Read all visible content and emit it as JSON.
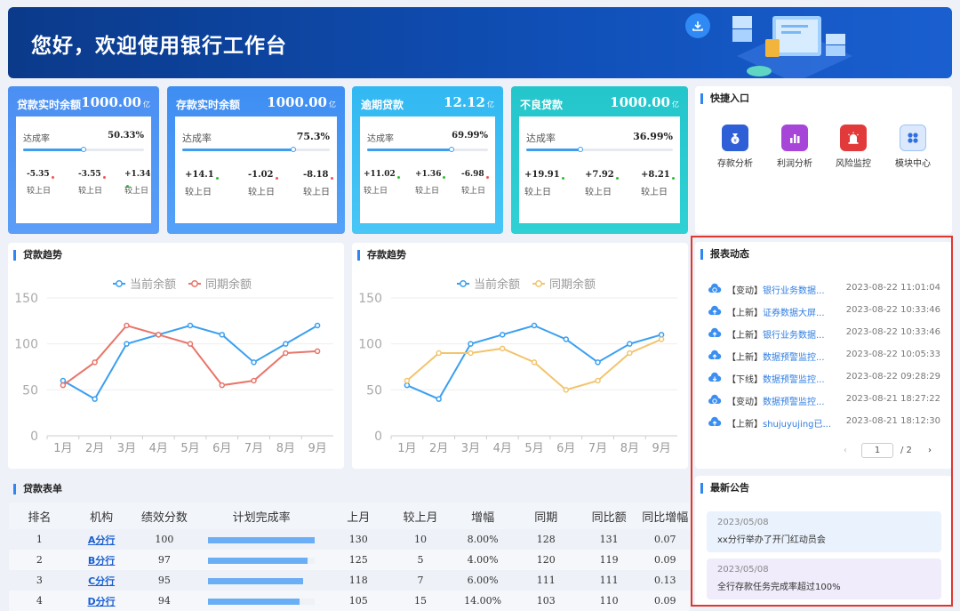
{
  "banner": {
    "title": "您好，欢迎使用银行工作台"
  },
  "cards": [
    {
      "title": "贷款实时余额",
      "value": "1000.00",
      "unit": "亿",
      "rate_label": "达成率",
      "rate": "50.33%",
      "rate_fraction": 0.5,
      "cmp": [
        {
          "v": "-5.35",
          "l": "较上日"
        },
        {
          "v": "-3.55",
          "l": "较上日"
        },
        {
          "v": "+1.34",
          "l": "较上日"
        }
      ]
    },
    {
      "title": "存款实时余额",
      "value": "1000.00",
      "unit": "亿",
      "rate_label": "达成率",
      "rate": "75.3%",
      "rate_fraction": 0.75,
      "cmp": [
        {
          "v": "+14.1",
          "l": "较上日"
        },
        {
          "v": "-1.02",
          "l": "较上日"
        },
        {
          "v": "-8.18",
          "l": "较上日"
        }
      ]
    },
    {
      "title": "逾期贷款",
      "value": "12.12",
      "unit": "亿",
      "rate_label": "达成率",
      "rate": "69.99%",
      "rate_fraction": 0.7,
      "cmp": [
        {
          "v": "+11.02",
          "l": "较上日"
        },
        {
          "v": "+1.36",
          "l": "较上日"
        },
        {
          "v": "-6.98",
          "l": "较上日"
        }
      ]
    },
    {
      "title": "不良贷款",
      "value": "1000.00",
      "unit": "亿",
      "rate_label": "达成率",
      "rate": "36.99%",
      "rate_fraction": 0.37,
      "cmp": [
        {
          "v": "+19.91",
          "l": "较上日"
        },
        {
          "v": "+7.92",
          "l": "较上日"
        },
        {
          "v": "+8.21",
          "l": "较上日"
        }
      ]
    }
  ],
  "quick": {
    "title": "快捷入口",
    "items": [
      {
        "label": "存款分析",
        "icon": "money-bag-icon",
        "color": "#2f5fd6"
      },
      {
        "label": "利润分析",
        "icon": "bar-chart-icon",
        "color": "#a645d8"
      },
      {
        "label": "风险监控",
        "icon": "alarm-icon",
        "color": "#e23a3a"
      },
      {
        "label": "模块中心",
        "icon": "grid-icon",
        "color": "#dce9fc"
      }
    ]
  },
  "reports": {
    "title": "报表动态",
    "items": [
      {
        "tag": "【变动】",
        "name": "银行业务数据...",
        "time": "2023-08-22 11:01:04",
        "icon": "cloud-sync-icon"
      },
      {
        "tag": "【上新】",
        "name": "证券数据大屏...",
        "time": "2023-08-22 10:33:46",
        "icon": "cloud-upload-icon"
      },
      {
        "tag": "【上新】",
        "name": "银行业务数据...",
        "time": "2023-08-22 10:33:46",
        "icon": "cloud-upload-icon"
      },
      {
        "tag": "【上新】",
        "name": "数据预警监控...",
        "time": "2023-08-22 10:05:33",
        "icon": "cloud-upload-icon"
      },
      {
        "tag": "【下线】",
        "name": "数据预警监控...",
        "time": "2023-08-22 09:28:29",
        "icon": "cloud-download-icon"
      },
      {
        "tag": "【变动】",
        "name": "数据预警监控...",
        "time": "2023-08-21 18:27:22",
        "icon": "cloud-sync-icon"
      },
      {
        "tag": "【上新】",
        "name": "shujuyujing已...",
        "time": "2023-08-21 18:12:30",
        "icon": "cloud-upload-icon"
      }
    ],
    "pager": {
      "current": "1",
      "total": "/ 2"
    }
  },
  "notices": {
    "title": "最新公告",
    "items": [
      {
        "date": "2023/05/08",
        "text": "xx分行举办了开门红动员会"
      },
      {
        "date": "2023/05/08",
        "text": "全行存款任务完成率超过100%"
      }
    ]
  },
  "chart_data": [
    {
      "type": "line",
      "panel_title": "贷款趋势",
      "x": [
        "1月",
        "2月",
        "3月",
        "4月",
        "5月",
        "6月",
        "7月",
        "8月",
        "9月"
      ],
      "ylim": [
        0,
        150
      ],
      "yticks": [
        "0",
        "50",
        "100",
        "150"
      ],
      "series": [
        {
          "name": "当前余额",
          "color": "#3a9ff0",
          "values": [
            60,
            40,
            100,
            110,
            120,
            110,
            80,
            100,
            120
          ]
        },
        {
          "name": "同期余额",
          "color": "#e8766a",
          "values": [
            55,
            80,
            120,
            110,
            100,
            55,
            60,
            90,
            92
          ]
        }
      ]
    },
    {
      "type": "line",
      "panel_title": "存款趋势",
      "x": [
        "1月",
        "2月",
        "3月",
        "4月",
        "5月",
        "6月",
        "7月",
        "8月",
        "9月"
      ],
      "ylim": [
        0,
        150
      ],
      "yticks": [
        "0",
        "50",
        "100",
        "150"
      ],
      "series": [
        {
          "name": "当前余额",
          "color": "#3a9ff0",
          "values": [
            55,
            40,
            100,
            110,
            120,
            105,
            80,
            100,
            110
          ]
        },
        {
          "name": "同期余额",
          "color": "#f2c46d",
          "values": [
            60,
            90,
            90,
            95,
            80,
            50,
            60,
            90,
            105
          ]
        }
      ]
    }
  ],
  "table": {
    "title": "贷款表单",
    "headers": [
      "排名",
      "机构",
      "绩效分数",
      "计划完成率",
      "上月",
      "较上月",
      "增幅",
      "同期",
      "同比额",
      "同比增幅"
    ],
    "rows": [
      {
        "rank": "1",
        "org": "A分行",
        "score": "100",
        "completion": 1.0,
        "last": "130",
        "diff": "10",
        "growth": "8.00%",
        "same": "128",
        "yoy": "131",
        "yoy_rate": "0.07"
      },
      {
        "rank": "2",
        "org": "B分行",
        "score": "97",
        "completion": 0.93,
        "last": "125",
        "diff": "5",
        "growth": "4.00%",
        "same": "120",
        "yoy": "119",
        "yoy_rate": "0.09"
      },
      {
        "rank": "3",
        "org": "C分行",
        "score": "95",
        "completion": 0.89,
        "last": "118",
        "diff": "7",
        "growth": "6.00%",
        "same": "111",
        "yoy": "111",
        "yoy_rate": "0.13"
      },
      {
        "rank": "4",
        "org": "D分行",
        "score": "94",
        "completion": 0.86,
        "last": "105",
        "diff": "15",
        "growth": "14.00%",
        "same": "103",
        "yoy": "110",
        "yoy_rate": "0.09"
      }
    ]
  }
}
